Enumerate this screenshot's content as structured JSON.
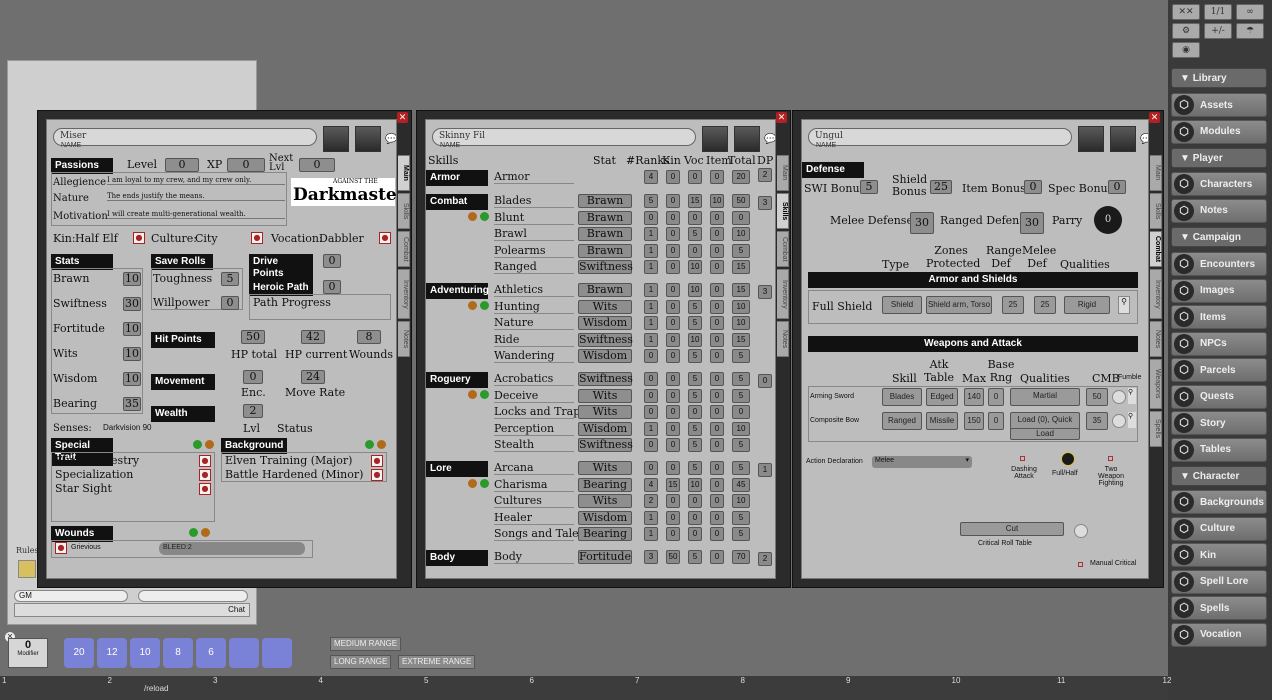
{
  "left": {
    "rules_label": "Rules",
    "gm": "GM",
    "chat_label": "Chat",
    "modifier": {
      "value": "0",
      "label": "Modifier"
    },
    "dice": [
      "20",
      "12",
      "10",
      "8",
      "6",
      "",
      ""
    ],
    "ranges": [
      "MEDIUM RANGE",
      "LONG RANGE",
      "EXTREME RANGE"
    ],
    "reload": "/reload",
    "ruler": [
      "1",
      "2",
      "3",
      "4",
      "5",
      "6",
      "7",
      "8",
      "9",
      "10",
      "11",
      "12"
    ]
  },
  "sidebar": {
    "tools": [
      "✕✕",
      "1/1",
      "∞",
      "⚙",
      "+/-",
      "☂",
      "◉"
    ],
    "library": "Library",
    "library_items": [
      "Assets",
      "Modules"
    ],
    "player": "Player",
    "player_items": [
      "Characters",
      "Notes"
    ],
    "campaign": "Campaign",
    "campaign_items": [
      "Encounters",
      "Images",
      "Items",
      "NPCs",
      "Parcels",
      "Quests",
      "Story",
      "Tables"
    ],
    "character": "Character",
    "character_items": [
      "Backgrounds",
      "Culture",
      "Kin",
      "Spell Lore",
      "Spells",
      "Vocation"
    ]
  },
  "c1": {
    "name": "Miser",
    "name_cap": "NAME",
    "passions": "Passions",
    "level_label": "Level",
    "level": "0",
    "xp_label": "XP",
    "xp": "0",
    "next_label": "Next Lvl",
    "next": "0",
    "allegiance_label": "Allegience",
    "allegiance": "I am loyal to my crew, and my crew only.",
    "nature_label": "Nature",
    "nature": "The ends justify the means.",
    "motivation_label": "Motivation",
    "motivation": "I will create multi-generational wealth.",
    "logo": "Darkmaster",
    "logo_small": "AGAINST THE",
    "kin_label": "Kin:",
    "kin": "Half Elf",
    "culture_label": "Culture:",
    "culture": "City",
    "vocation_label": "Vocation:",
    "vocation": "Dabbler",
    "stats_h": "Stats",
    "stats": [
      {
        "n": "Brawn",
        "v": "10"
      },
      {
        "n": "Swiftness",
        "v": "30"
      },
      {
        "n": "Fortitude",
        "v": "10"
      },
      {
        "n": "Wits",
        "v": "10"
      },
      {
        "n": "Wisdom",
        "v": "10"
      },
      {
        "n": "Bearing",
        "v": "35"
      }
    ],
    "save_h": "Save Rolls",
    "saves": [
      {
        "n": "Toughness",
        "v": "5"
      },
      {
        "n": "Willpower",
        "v": "0"
      }
    ],
    "drive_h": "Drive Points",
    "drive": "0",
    "heroic_h": "Heroic Path",
    "heroic": "0",
    "path_progress": "Path Progress",
    "hp_h": "Hit Points",
    "hp_total": "50",
    "hp_current": "42",
    "wounds": "8",
    "hp_total_l": "HP total",
    "hp_current_l": "HP current",
    "wounds_l": "Wounds",
    "move_h": "Movement",
    "enc": "0",
    "move_rate": "24",
    "enc_l": "Enc.",
    "move_rate_l": "Move Rate",
    "wealth_h": "Wealth",
    "wealth": "2",
    "lvl_l": "Lvl",
    "status_l": "Status",
    "senses_l": "Senses:",
    "senses": "Darkvision 90",
    "special_h": "Special Trait",
    "special": [
      "Elven Ancestry",
      "Specialization",
      "Star Sight"
    ],
    "background_h": "Background",
    "background": [
      "Elven Training (Major)",
      "Battle Hardened (Minor)"
    ],
    "wounds_h": "Wounds",
    "wound_name": "Grievious",
    "wound_effect": "BLEED:2",
    "tabs": [
      "Main",
      "Skills",
      "Combat",
      "Inventory",
      "Notes"
    ]
  },
  "c2": {
    "name": "Skinny Fil",
    "name_cap": "NAME",
    "cols": [
      "Skills",
      "Stat",
      "#Ranks",
      "Kin",
      "Voc",
      "Item",
      "Total",
      "DP"
    ],
    "groups": [
      {
        "h": "Armor",
        "dp": "2",
        "skills": [
          {
            "n": "Armor",
            "stat": "",
            "v": [
              "4",
              "0",
              "0",
              "0",
              "20"
            ]
          }
        ]
      },
      {
        "h": "Combat",
        "dp": "3",
        "skills": [
          {
            "n": "Blades",
            "stat": "Brawn",
            "v": [
              "5",
              "0",
              "15",
              "10",
              "50"
            ]
          },
          {
            "n": "Blunt",
            "stat": "Brawn",
            "v": [
              "0",
              "0",
              "0",
              "0",
              "0"
            ]
          },
          {
            "n": "Brawl",
            "stat": "Brawn",
            "v": [
              "1",
              "0",
              "5",
              "0",
              "10"
            ]
          },
          {
            "n": "Polearms",
            "stat": "Brawn",
            "v": [
              "1",
              "0",
              "0",
              "0",
              "5"
            ]
          },
          {
            "n": "Ranged",
            "stat": "Swiftness",
            "v": [
              "1",
              "0",
              "10",
              "0",
              "15"
            ]
          }
        ]
      },
      {
        "h": "Adventuring",
        "dp": "3",
        "skills": [
          {
            "n": "Athletics",
            "stat": "Brawn",
            "v": [
              "1",
              "0",
              "10",
              "0",
              "15"
            ]
          },
          {
            "n": "Hunting",
            "stat": "Wits",
            "v": [
              "1",
              "0",
              "5",
              "0",
              "10"
            ]
          },
          {
            "n": "Nature",
            "stat": "Wisdom",
            "v": [
              "1",
              "0",
              "5",
              "0",
              "10"
            ]
          },
          {
            "n": "Ride",
            "stat": "Swiftness",
            "v": [
              "1",
              "0",
              "10",
              "0",
              "15"
            ]
          },
          {
            "n": "Wandering",
            "stat": "Wisdom",
            "v": [
              "0",
              "0",
              "5",
              "0",
              "5"
            ]
          }
        ]
      },
      {
        "h": "Roguery",
        "dp": "0",
        "skills": [
          {
            "n": "Acrobatics",
            "stat": "Swiftness",
            "v": [
              "0",
              "0",
              "5",
              "0",
              "5"
            ]
          },
          {
            "n": "Deceive",
            "stat": "Wits",
            "v": [
              "0",
              "0",
              "5",
              "0",
              "5"
            ]
          },
          {
            "n": "Locks and Traps",
            "stat": "Wits",
            "v": [
              "0",
              "0",
              "0",
              "0",
              "0"
            ]
          },
          {
            "n": "Perception",
            "stat": "Wisdom",
            "v": [
              "1",
              "0",
              "5",
              "0",
              "10"
            ]
          },
          {
            "n": "Stealth",
            "stat": "Swiftness",
            "v": [
              "0",
              "0",
              "5",
              "0",
              "5"
            ]
          }
        ]
      },
      {
        "h": "Lore",
        "dp": "1",
        "skills": [
          {
            "n": "Arcana",
            "stat": "Wits",
            "v": [
              "0",
              "0",
              "5",
              "0",
              "5"
            ]
          },
          {
            "n": "Charisma",
            "stat": "Bearing",
            "v": [
              "4",
              "15",
              "10",
              "0",
              "45"
            ]
          },
          {
            "n": "Cultures",
            "stat": "Wits",
            "v": [
              "2",
              "0",
              "0",
              "0",
              "10"
            ]
          },
          {
            "n": "Healer",
            "stat": "Wisdom",
            "v": [
              "1",
              "0",
              "0",
              "0",
              "5"
            ]
          },
          {
            "n": "Songs and Tales",
            "stat": "Bearing",
            "v": [
              "1",
              "0",
              "0",
              "0",
              "5"
            ]
          }
        ]
      },
      {
        "h": "Body",
        "dp": "2",
        "skills": [
          {
            "n": "Body",
            "stat": "Fortitude",
            "v": [
              "3",
              "50",
              "5",
              "0",
              "70"
            ]
          }
        ]
      }
    ],
    "tabs": [
      "Main",
      "Skills",
      "Combat",
      "Inventory",
      "Notes"
    ]
  },
  "c3": {
    "name": "Ungul",
    "name_cap": "NAME",
    "defense_h": "Defense",
    "swi_l": "SWI Bonus",
    "swi": "5",
    "shield_l": "Shield Bonus",
    "shield": "25",
    "item_l": "Item Bonus",
    "item": "0",
    "spec_l": "Spec Bonus",
    "spec": "0",
    "melee_def_l": "Melee Defense",
    "melee_def": "30",
    "ranged_def_l": "Ranged Defense",
    "ranged_def": "30",
    "parry_l": "Parry",
    "parry": "0",
    "armor_cols": [
      "Type",
      "Zones Protected",
      "Range Def",
      "Melee Def",
      "Qualities"
    ],
    "armor_h": "Armor and Shields",
    "armor": {
      "name": "Full Shield",
      "type": "Shield",
      "zones": "Shield arm, Torso",
      "range": "25",
      "melee": "25",
      "qual": "Rigid"
    },
    "weap_h": "Weapons and Attack",
    "weap_cols": [
      "Skill",
      "Atk Table",
      "Max",
      "Base Rng",
      "Qualities",
      "CMB",
      "Fumble"
    ],
    "weapons": [
      {
        "name": "Arming Sword",
        "skill": "Blades",
        "table": "Edged",
        "max": "140",
        "rng": "0",
        "qual": "Martial",
        "qual2": "",
        "cmb": "50"
      },
      {
        "name": "Composite Bow",
        "skill": "Ranged",
        "table": "Missile",
        "max": "150",
        "rng": "0",
        "qual": "Load (0), Quick",
        "qual2": "Load",
        "cmb": "35"
      }
    ],
    "action_l": "Action Declaration",
    "action": "Melee",
    "dashing": "Dashing Attack",
    "fullhalf": "Full/Half",
    "twoweap": "Two Weapon Fighting",
    "cut": "Cut",
    "crit_l": "Critical Roll Table",
    "manual": "Manual Critical",
    "tabs": [
      "Main",
      "Skills",
      "Combat",
      "Inventory",
      "Notes",
      "Weapons",
      "Spells"
    ]
  }
}
